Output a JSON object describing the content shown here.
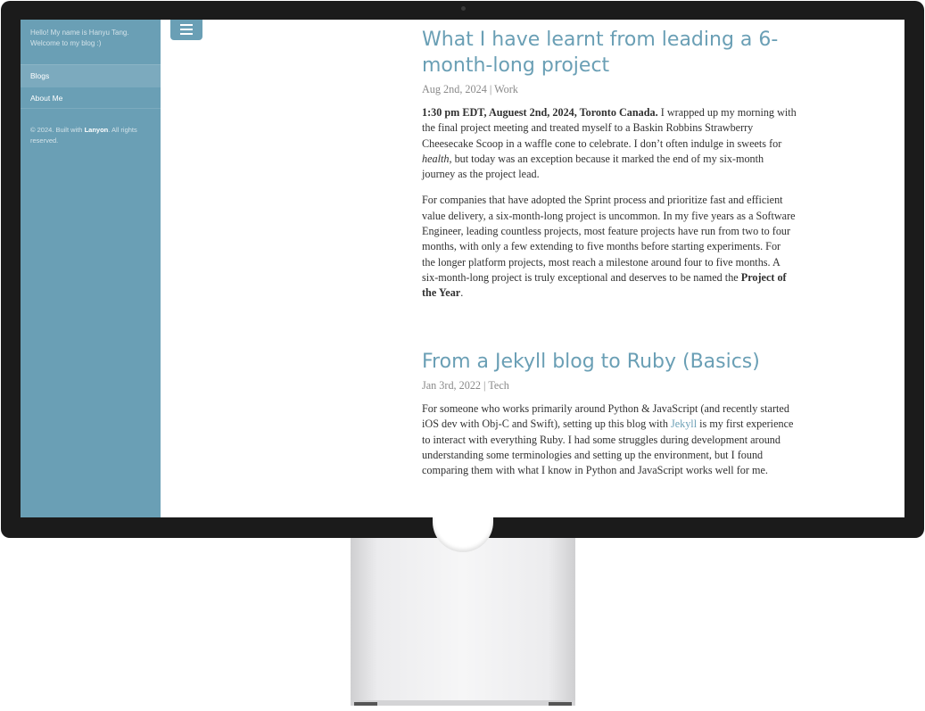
{
  "sidebar": {
    "intro_line1": "Hello! My name is Hanyu Tang.",
    "intro_line2": "Welcome to my blog :)",
    "nav": [
      {
        "label": "Blogs"
      },
      {
        "label": "About Me"
      }
    ],
    "footer_prefix": "© 2024. Built with ",
    "footer_brand": "Lanyon",
    "footer_suffix": ". All rights reserved."
  },
  "toggle": {
    "icon": "hamburger-icon"
  },
  "posts": [
    {
      "title": "What I have learnt from leading a 6-month-long project",
      "date": "Aug 2nd, 2024 | Work",
      "p1_bold": "1:30 pm EDT, Auguest 2nd, 2024, Toronto Canada.",
      "p1_text_a": " I wrapped up my morning with the final project meeting and treated myself to a Baskin Robbins Strawberry Cheesecake Scoop in a waffle cone to celebrate. I don’t often indulge in sweets for ",
      "p1_italic": "health",
      "p1_text_b": ", but today was an exception because it marked the end of my six-month journey as the project lead.",
      "p2_text": "For companies that have adopted the Sprint process and prioritize fast and efficient value delivery, a six-month-long project is uncommon. In my five years as a Software Engineer, leading countless projects, most feature projects have run from two to four months, with only a few extending to five months before starting experiments. For the longer platform projects, most reach a milestone around four to five months. A six-month-long project is truly exceptional and deserves to be named the ",
      "p2_bold": "Project of the Year",
      "p2_end": "."
    },
    {
      "title": "From a Jekyll blog to Ruby (Basics)",
      "date": "Jan 3rd, 2022 | Tech",
      "p1_text_a": "For someone who works primarily around Python & JavaScript (and recently started iOS dev with Obj-C and Swift), setting up this blog with ",
      "p1_link": "Jekyll",
      "p1_text_b": " is my first experience to interact with everything Ruby. I had some struggles during development around understanding some terminologies and setting up the environment, but I found comparing them with what I know in Python and JavaScript works well for me."
    }
  ],
  "colors": {
    "accent": "#6a9fb5",
    "text": "#313131",
    "muted": "#8a8a8a",
    "bezel": "#1b1b1b"
  }
}
